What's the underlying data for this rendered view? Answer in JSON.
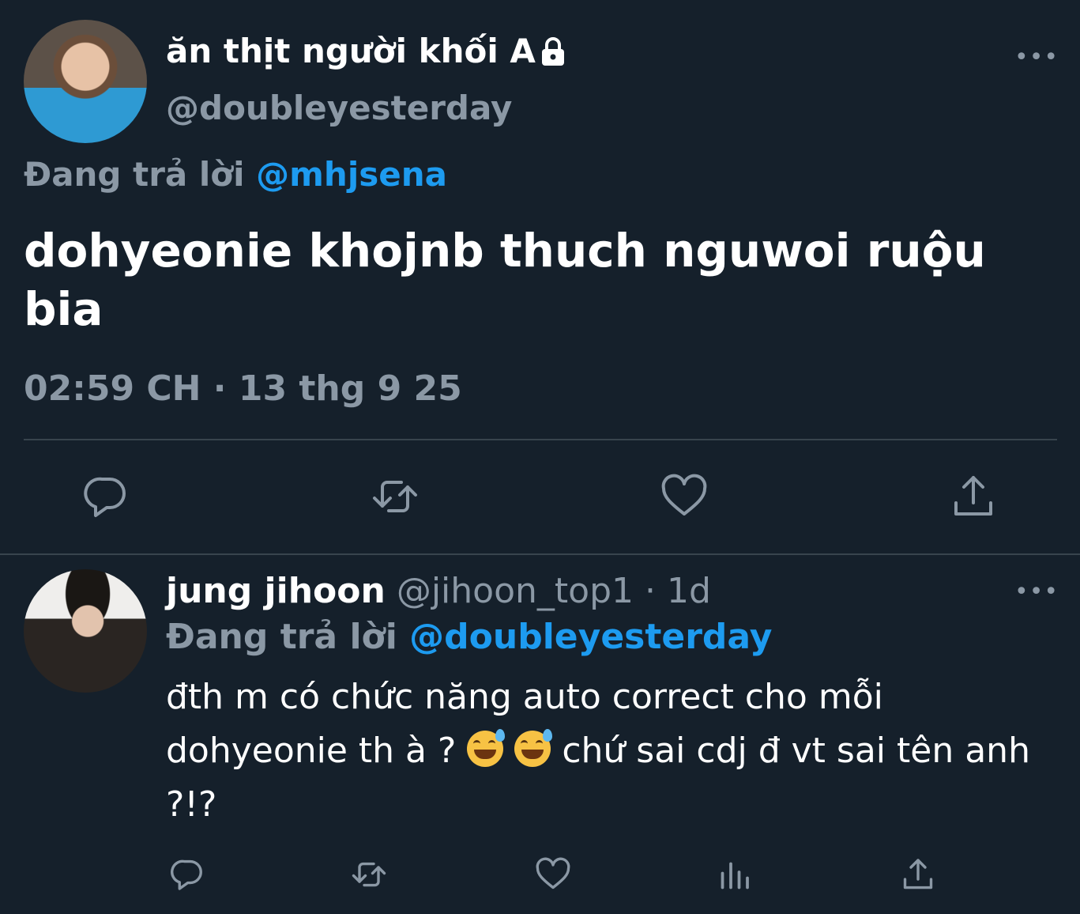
{
  "main_tweet": {
    "display_name": "ăn thịt người khối A",
    "protected_icon": "lock-icon",
    "handle": "@doubleyesterday",
    "replying_prefix": "Đang trả lời",
    "replying_to": "@mhjsena",
    "text": "dohyeonie khojnb thuch nguwoi ruộu bia",
    "timestamp": "02:59 CH · 13 thg 9 25",
    "more_label": "•••",
    "actions": [
      "reply-icon",
      "retweet-icon",
      "like-icon",
      "share-icon"
    ]
  },
  "reply_tweet": {
    "display_name": "jung jihoon",
    "handle": "@jihoon_top1",
    "separator": " · ",
    "age": "1d",
    "replying_prefix": "Đang trả lời",
    "replying_to": "@doubleyesterday",
    "text_part1": "đth m có chức năng auto correct cho mỗi dohyeonie th à ? ",
    "emoji_name": "grinning-face-with-sweat",
    "text_part2": "  chứ sai cdj đ vt sai tên anh ?!?",
    "more_label": "•••",
    "actions": [
      "reply-icon",
      "retweet-icon",
      "like-icon",
      "stats-icon",
      "share-icon"
    ]
  },
  "colors": {
    "background": "#15202b",
    "text": "#ffffff",
    "muted": "#8b98a5",
    "link": "#1d9bf0",
    "divider": "#38444d"
  }
}
